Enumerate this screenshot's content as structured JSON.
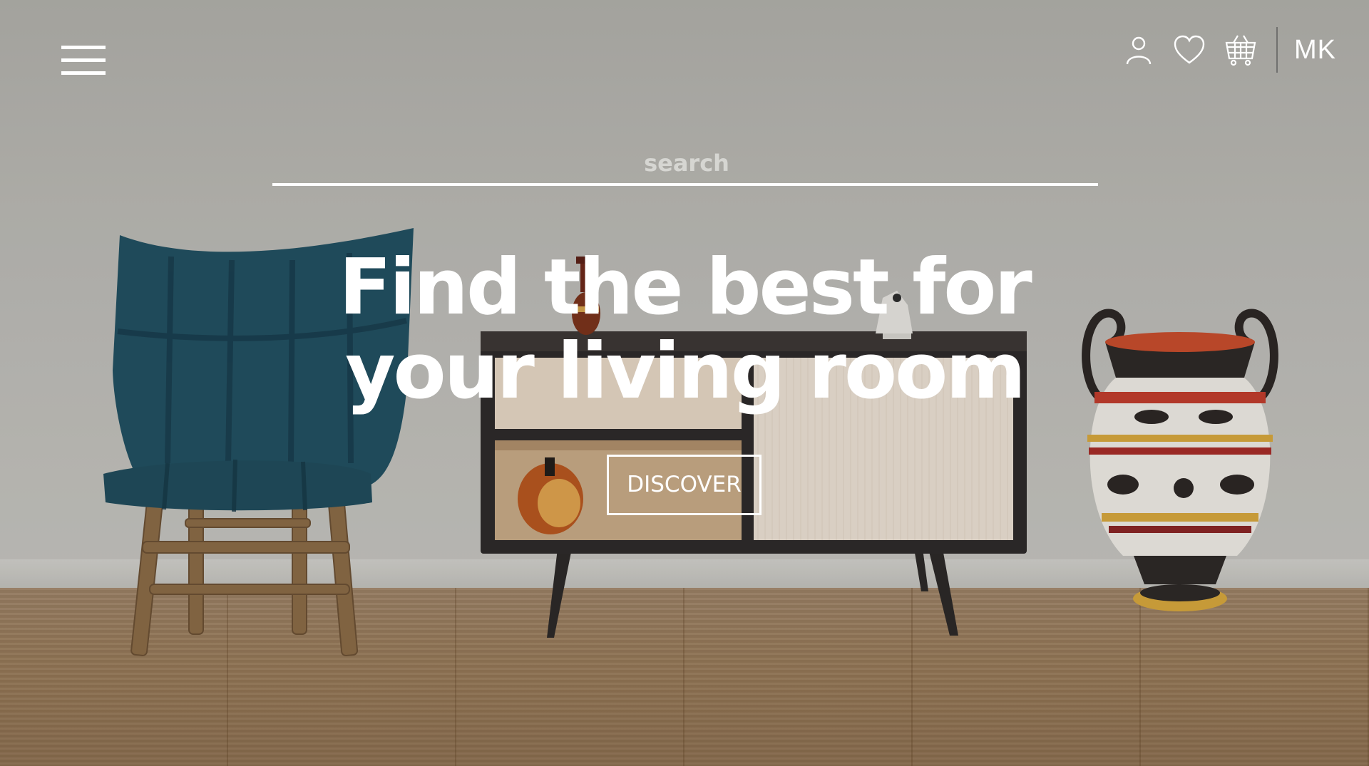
{
  "nav": {
    "menu_icon": "hamburger-menu-icon",
    "icons": [
      "user-icon",
      "heart-icon",
      "shopping-basket-icon"
    ],
    "user_initials": "MK"
  },
  "search": {
    "placeholder": "search",
    "value": ""
  },
  "hero": {
    "title_line1": "Find the best for",
    "title_line2": "your living room",
    "cta_label": "DISCOVER"
  },
  "colors": {
    "text": "#ffffff",
    "chair_fabric": "#1f4f60",
    "cabinet_frame": "#2b2827",
    "cabinet_door": "#eee3d5",
    "floor_wood": "#9a7b58"
  }
}
